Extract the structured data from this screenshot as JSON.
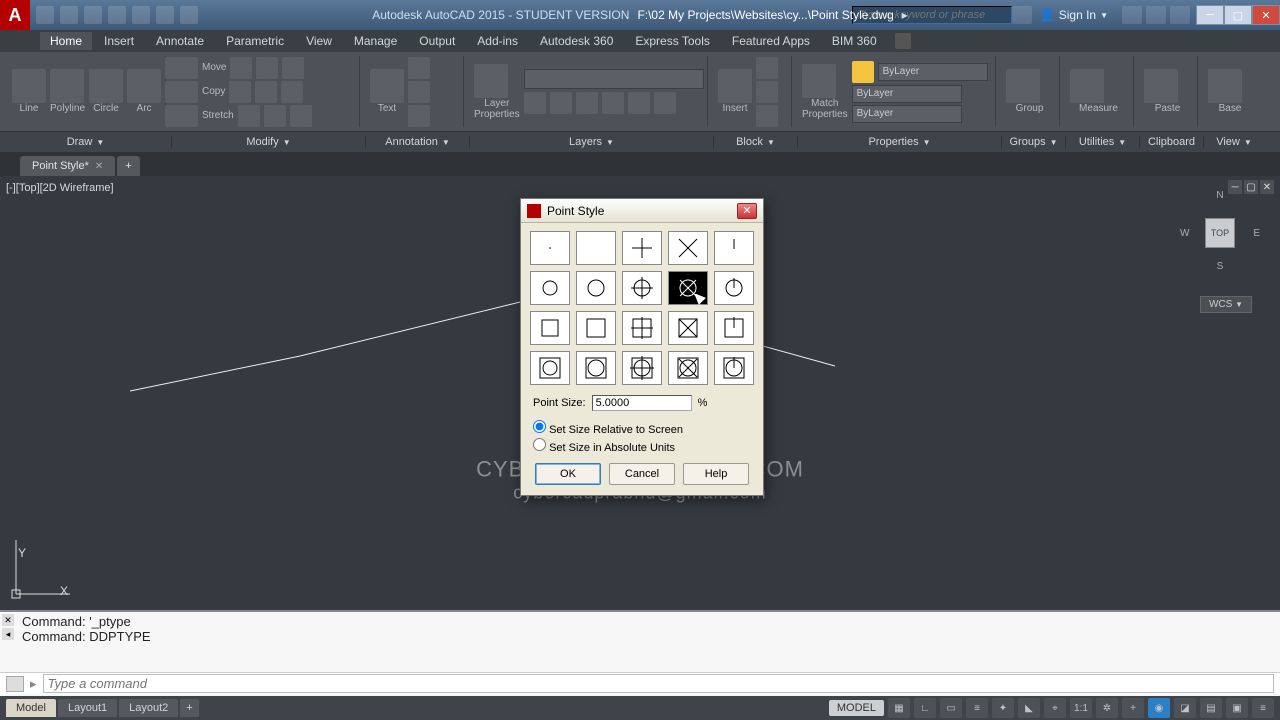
{
  "title": {
    "app": "Autodesk AutoCAD 2015 - STUDENT VERSION",
    "file": "F:\\02 My Projects\\Websites\\cy...\\Point Style.dwg",
    "search_placeholder": "Type a keyword or phrase",
    "signin": "Sign In"
  },
  "menu": [
    "Home",
    "Insert",
    "Annotate",
    "Parametric",
    "View",
    "Manage",
    "Output",
    "Add-ins",
    "Autodesk 360",
    "Express Tools",
    "Featured Apps",
    "BIM 360"
  ],
  "ribbon_panels": [
    "Draw",
    "Modify",
    "Annotation",
    "Layers",
    "Block",
    "Properties",
    "Groups",
    "Utilities",
    "Clipboard",
    "View"
  ],
  "ribbon": {
    "draw": {
      "line": "Line",
      "polyline": "Polyline",
      "circle": "Circle",
      "arc": "Arc"
    },
    "modify": {
      "move": "Move",
      "copy": "Copy",
      "stretch": "Stretch"
    },
    "annotation": {
      "text": "Text"
    },
    "layers": {
      "props": "Layer\nProperties"
    },
    "block": {
      "insert": "Insert"
    },
    "properties": {
      "match": "Match\nProperties",
      "bylayer": "ByLayer"
    },
    "groups": {
      "group": "Group"
    },
    "utilities": {
      "measure": "Measure"
    },
    "clipboard": {
      "paste": "Paste"
    },
    "view": {
      "base": "Base"
    }
  },
  "doc_tab": "Point Style*",
  "viewport_label": "[-][Top][2D Wireframe]",
  "viewcube": {
    "n": "N",
    "s": "S",
    "e": "E",
    "w": "W",
    "top": "TOP",
    "wcs": "WCS"
  },
  "watermark": {
    "l1": "CYBERCADSOLUTIONS.COM",
    "l2": "cybercadprabhu@gmail.com"
  },
  "dialog": {
    "title": "Point Style",
    "size_label": "Point Size:",
    "size_value": "5.0000",
    "unit": "%",
    "radio_relative": "Set Size Relative to Screen",
    "radio_absolute": "Set Size in Absolute Units",
    "ok": "OK",
    "cancel": "Cancel",
    "help": "Help",
    "selected_index": 8
  },
  "command": {
    "hist1": "Command: '_ptype",
    "hist2": "Command: DDPTYPE",
    "placeholder": "Type a command"
  },
  "bottom_tabs": [
    "Model",
    "Layout1",
    "Layout2"
  ],
  "status": {
    "model": "MODEL",
    "scale": "1:1"
  }
}
